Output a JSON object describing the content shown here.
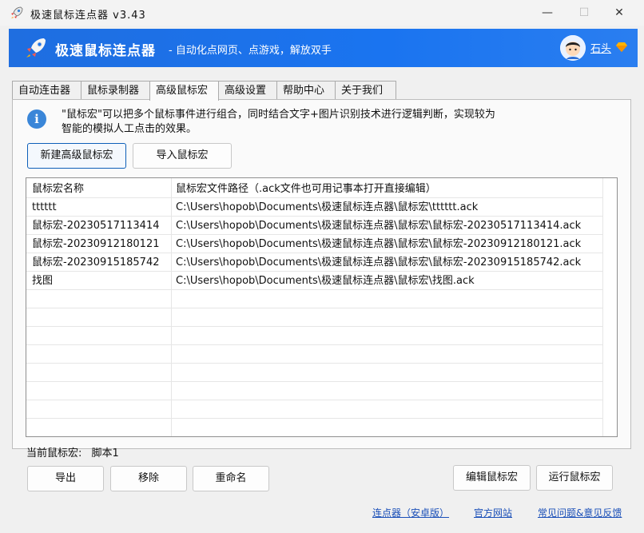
{
  "window": {
    "title": "极速鼠标连点器 v3.43",
    "minimize": "—",
    "maximize": "☐",
    "close": "✕"
  },
  "banner": {
    "brand": "极速鼠标连点器",
    "slogan": "- 自动化点网页、点游戏，解放双手",
    "username": "石头",
    "accent": "#1a74f0"
  },
  "tabs": [
    "自动连击器",
    "鼠标录制器",
    "高级鼠标宏",
    "高级设置",
    "帮助中心",
    "关于我们"
  ],
  "active_tab": "高级鼠标宏",
  "info": {
    "icon": "info-icon",
    "text_line1": "\"鼠标宏\"可以把多个鼠标事件进行组合，同时结合文字+图片识别技术进行逻辑判断，实现较为",
    "text_line2": "智能的模拟人工点击的效果。"
  },
  "actions": {
    "new_macro": "新建高级鼠标宏",
    "import_macro": "导入鼠标宏"
  },
  "table": {
    "headers": [
      "鼠标宏名称",
      "鼠标宏文件路径（.ack文件也可用记事本打开直接编辑）"
    ],
    "rows": [
      [
        "tttttt",
        "C:\\Users\\hopob\\Documents\\极速鼠标连点器\\鼠标宏\\tttttt.ack"
      ],
      [
        "鼠标宏-20230517113414",
        "C:\\Users\\hopob\\Documents\\极速鼠标连点器\\鼠标宏\\鼠标宏-20230517113414.ack"
      ],
      [
        "鼠标宏-20230912180121",
        "C:\\Users\\hopob\\Documents\\极速鼠标连点器\\鼠标宏\\鼠标宏-20230912180121.ack"
      ],
      [
        "鼠标宏-20230915185742",
        "C:\\Users\\hopob\\Documents\\极速鼠标连点器\\鼠标宏\\鼠标宏-20230915185742.ack"
      ],
      [
        "找图",
        "C:\\Users\\hopob\\Documents\\极速鼠标连点器\\鼠标宏\\找图.ack"
      ]
    ]
  },
  "current_macro": {
    "label": "当前鼠标宏:",
    "value": "脚本1"
  },
  "bottom_buttons": {
    "export": "导出",
    "remove": "移除",
    "rename": "重命名",
    "edit": "编辑鼠标宏",
    "run": "运行鼠标宏"
  },
  "footer_links": [
    "连点器（安卓版）",
    "官方网站",
    "常见问题&意见反馈"
  ]
}
